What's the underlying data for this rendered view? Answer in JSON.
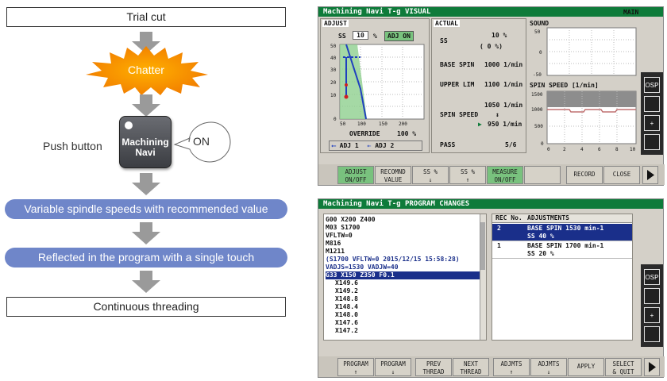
{
  "flow": {
    "trial_cut": "Trial cut",
    "chatter": "Chatter",
    "push_button": "Push button",
    "machining_navi_line1": "Machining",
    "machining_navi_line2": "Navi",
    "on": "ON",
    "variable_spindle": "Variable spindle speeds with recommended value",
    "reflected": "Reflected in the program with a single touch",
    "continuous": "Continuous threading"
  },
  "visual": {
    "title": "Machining Navi T-g VISUAL",
    "main": "MAIN",
    "adjust_label": "ADJUST",
    "actual_label": "ACTUAL",
    "sound_label": "SOUND",
    "ss_label": "SS",
    "ss_value": "10",
    "ss_unit": "%",
    "adj_on": "ADJ ON",
    "override_label": "OVERRIDE",
    "override_value": "100 %",
    "adj1": "ADJ 1",
    "adj2": "ADJ 2",
    "actual_ss_label": "SS",
    "actual_ss_line1": "10 %",
    "actual_ss_line2": "( 0 %)",
    "base_spin_label": "BASE SPIN",
    "base_spin_value": "1000 1/min",
    "upper_lim_label": "UPPER LIM",
    "upper_lim_value": "1100 1/min",
    "spin_speed_label": "SPIN SPEED",
    "spin_speed_top": "1050 1/min",
    "spin_speed_arrow": "↕",
    "spin_speed_bottom": "950 1/min",
    "pass_label": "PASS",
    "pass_value": "5/6",
    "spin_speed_chart_label": "SPIN SPEED [1/min]",
    "adjust_y_ticks": [
      "50",
      "40",
      "30",
      "20",
      "10",
      "0"
    ],
    "adjust_x_ticks": [
      "50",
      "100",
      "150",
      "200"
    ],
    "sound_y_ticks": [
      "50",
      "0",
      "-50"
    ],
    "spin_y_ticks": [
      "1500",
      "1000",
      "500",
      "0"
    ],
    "spin_x_ticks": [
      "0",
      "2",
      "4",
      "6",
      "8",
      "10"
    ],
    "fkeys": [
      {
        "label": "ADJUST\nON/OFF",
        "green": true
      },
      {
        "label": "RECOMND\nVALUE",
        "green": false
      },
      {
        "label": "SS %\n↓",
        "green": false
      },
      {
        "label": "SS %\n↑",
        "green": false
      },
      {
        "label": "MEASURE\nON/OFF",
        "green": true
      },
      {
        "label": "",
        "green": false
      },
      {
        "label": "RECORD",
        "green": false
      },
      {
        "label": "CLOSE",
        "green": false
      }
    ],
    "side_icons": [
      "OSP",
      "",
      "+",
      ""
    ]
  },
  "program": {
    "title": "Machining Navi T-g PROGRAM CHANGES",
    "lines": [
      {
        "text": "G00 X200 Z400",
        "style": "normal"
      },
      {
        "text": "M03 S1700",
        "style": "normal"
      },
      {
        "text": "VFLTW=0",
        "style": "normal"
      },
      {
        "text": "M816",
        "style": "normal"
      },
      {
        "text": "M1211",
        "style": "normal"
      },
      {
        "text": "(S1700 VFLTW=0 2015/12/15 15:58:28)",
        "style": "blue"
      },
      {
        "text": "VADJS=1530 VADJW=40",
        "style": "blue"
      },
      {
        "text": "G33 X150 Z350 F0.1",
        "style": "selected"
      },
      {
        "text": "X149.6",
        "style": "indent"
      },
      {
        "text": "X149.2",
        "style": "indent"
      },
      {
        "text": "X148.8",
        "style": "indent"
      },
      {
        "text": "X148.4",
        "style": "indent"
      },
      {
        "text": "X148.0",
        "style": "indent"
      },
      {
        "text": "X147.6",
        "style": "indent"
      },
      {
        "text": "X147.2",
        "style": "indent"
      }
    ],
    "rec_header": "REC No.",
    "adj_header": "ADJUSTMENTS",
    "records": [
      {
        "no": "2",
        "line1": "BASE SPIN 1530 min-1",
        "line2": "SS 40 %",
        "selected": true
      },
      {
        "no": "1",
        "line1": "BASE SPIN 1700 min-1",
        "line2": "SS 20 %",
        "selected": false
      }
    ],
    "fkeys": [
      {
        "label": "PROGRAM\n↑"
      },
      {
        "label": "PROGRAM\n↓"
      },
      {
        "label": "PREV\nTHREAD"
      },
      {
        "label": "NEXT\nTHREAD"
      },
      {
        "label": "ADJMTS\n↑"
      },
      {
        "label": "ADJMTS\n↓"
      },
      {
        "label": "APPLY"
      },
      {
        "label": "SELECT\n& QUIT"
      }
    ],
    "side_icons": [
      "OSP",
      "",
      "+",
      ""
    ]
  }
}
